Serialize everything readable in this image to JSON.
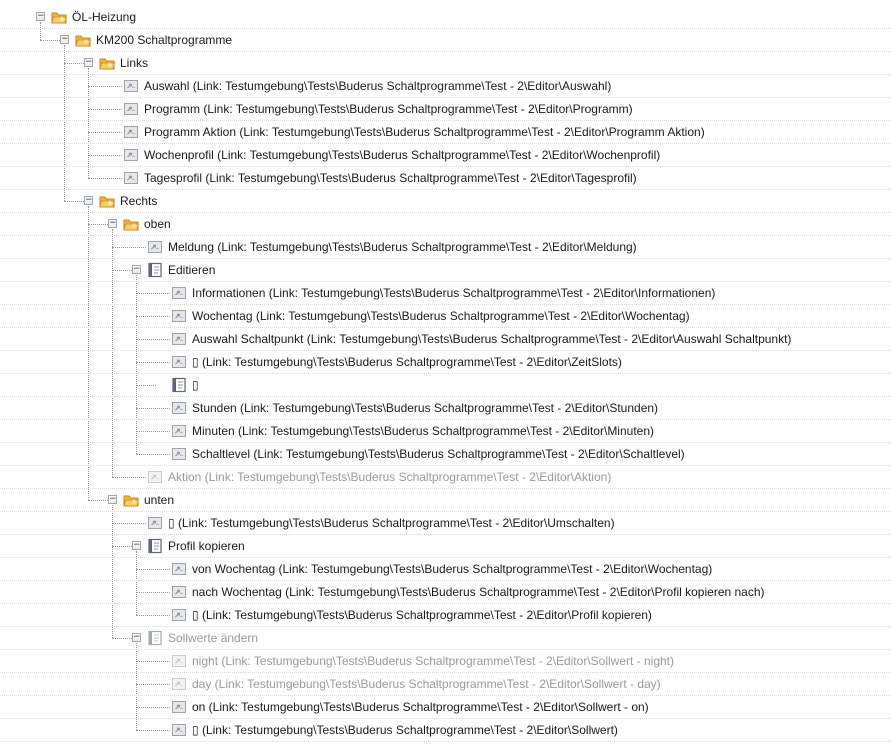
{
  "tree": [
    {
      "depth": 0,
      "type": "folder",
      "label": "ÖL-Heizung",
      "expanded": true,
      "dim": false
    },
    {
      "depth": 1,
      "type": "folder",
      "label": "KM200 Schaltprogramme",
      "expanded": true,
      "dim": false
    },
    {
      "depth": 2,
      "type": "folder",
      "label": "Links",
      "expanded": true,
      "dim": false
    },
    {
      "depth": 3,
      "type": "link",
      "label": "Auswahl (Link: Testumgebung\\Tests\\Buderus Schaltprogramme\\Test - 2\\Editor\\Auswahl)",
      "dim": false
    },
    {
      "depth": 3,
      "type": "link",
      "label": "Programm (Link: Testumgebung\\Tests\\Buderus Schaltprogramme\\Test - 2\\Editor\\Programm)",
      "dim": false
    },
    {
      "depth": 3,
      "type": "link",
      "label": "Programm Aktion (Link: Testumgebung\\Tests\\Buderus Schaltprogramme\\Test - 2\\Editor\\Programm Aktion)",
      "dim": false
    },
    {
      "depth": 3,
      "type": "link",
      "label": "Wochenprofil (Link: Testumgebung\\Tests\\Buderus Schaltprogramme\\Test - 2\\Editor\\Wochenprofil)",
      "dim": false
    },
    {
      "depth": 3,
      "type": "link",
      "label": "Tagesprofil (Link: Testumgebung\\Tests\\Buderus Schaltprogramme\\Test - 2\\Editor\\Tagesprofil)",
      "dim": false
    },
    {
      "depth": 2,
      "type": "folder",
      "label": "Rechts",
      "expanded": true,
      "dim": false
    },
    {
      "depth": 3,
      "type": "folder",
      "label": "oben",
      "expanded": true,
      "dim": false
    },
    {
      "depth": 4,
      "type": "link",
      "label": "Meldung (Link: Testumgebung\\Tests\\Buderus Schaltprogramme\\Test - 2\\Editor\\Meldung)",
      "dim": false
    },
    {
      "depth": 4,
      "type": "book",
      "label": "Editieren",
      "expanded": true,
      "dim": false
    },
    {
      "depth": 5,
      "type": "link",
      "label": "Informationen (Link: Testumgebung\\Tests\\Buderus Schaltprogramme\\Test - 2\\Editor\\Informationen)",
      "dim": false
    },
    {
      "depth": 5,
      "type": "link",
      "label": "Wochentag (Link: Testumgebung\\Tests\\Buderus Schaltprogramme\\Test - 2\\Editor\\Wochentag)",
      "dim": false
    },
    {
      "depth": 5,
      "type": "link",
      "label": "Auswahl Schaltpunkt (Link: Testumgebung\\Tests\\Buderus Schaltprogramme\\Test - 2\\Editor\\Auswahl Schaltpunkt)",
      "dim": false
    },
    {
      "depth": 5,
      "type": "link",
      "label": "▯ (Link: Testumgebung\\Tests\\Buderus Schaltprogramme\\Test - 2\\Editor\\ZeitSlots)",
      "dim": false
    },
    {
      "depth": 5,
      "type": "book",
      "label": "▯",
      "dim": false
    },
    {
      "depth": 5,
      "type": "link",
      "label": "Stunden (Link: Testumgebung\\Tests\\Buderus Schaltprogramme\\Test - 2\\Editor\\Stunden)",
      "dim": false
    },
    {
      "depth": 5,
      "type": "link",
      "label": "Minuten (Link: Testumgebung\\Tests\\Buderus Schaltprogramme\\Test - 2\\Editor\\Minuten)",
      "dim": false
    },
    {
      "depth": 5,
      "type": "link",
      "label": "Schaltlevel (Link: Testumgebung\\Tests\\Buderus Schaltprogramme\\Test - 2\\Editor\\Schaltlevel)",
      "dim": false
    },
    {
      "depth": 4,
      "type": "link",
      "label": "Aktion (Link: Testumgebung\\Tests\\Buderus Schaltprogramme\\Test - 2\\Editor\\Aktion)",
      "dim": true
    },
    {
      "depth": 3,
      "type": "folder",
      "label": "unten",
      "expanded": true,
      "dim": false
    },
    {
      "depth": 4,
      "type": "link",
      "label": "▯ (Link: Testumgebung\\Tests\\Buderus Schaltprogramme\\Test - 2\\Editor\\Umschalten)",
      "dim": false
    },
    {
      "depth": 4,
      "type": "book",
      "label": "Profil kopieren",
      "expanded": true,
      "dim": false
    },
    {
      "depth": 5,
      "type": "link",
      "label": "von Wochentag (Link: Testumgebung\\Tests\\Buderus Schaltprogramme\\Test - 2\\Editor\\Wochentag)",
      "dim": false
    },
    {
      "depth": 5,
      "type": "link",
      "label": "nach Wochentag (Link: Testumgebung\\Tests\\Buderus Schaltprogramme\\Test - 2\\Editor\\Profil kopieren nach)",
      "dim": false
    },
    {
      "depth": 5,
      "type": "link",
      "label": "▯ (Link: Testumgebung\\Tests\\Buderus Schaltprogramme\\Test - 2\\Editor\\Profil kopieren)",
      "dim": false
    },
    {
      "depth": 4,
      "type": "book",
      "label": "Sollwerte ändern",
      "expanded": true,
      "dim": true
    },
    {
      "depth": 5,
      "type": "link",
      "label": "night (Link: Testumgebung\\Tests\\Buderus Schaltprogramme\\Test - 2\\Editor\\Sollwert - night)",
      "dim": true
    },
    {
      "depth": 5,
      "type": "link",
      "label": "day (Link: Testumgebung\\Tests\\Buderus Schaltprogramme\\Test - 2\\Editor\\Sollwert - day)",
      "dim": true
    },
    {
      "depth": 5,
      "type": "link",
      "label": "on (Link: Testumgebung\\Tests\\Buderus Schaltprogramme\\Test - 2\\Editor\\Sollwert - on)",
      "dim": false
    },
    {
      "depth": 5,
      "type": "link",
      "label": "▯ (Link: Testumgebung\\Tests\\Buderus Schaltprogramme\\Test - 2\\Editor\\Sollwert)",
      "dim": false
    }
  ],
  "icons": {
    "folder": "folder-icon",
    "link": "link-icon",
    "book": "book-icon"
  },
  "colors": {
    "folder": "#f0b43a",
    "link_bg": "#e6e8ec",
    "book": "#5b6678",
    "grid": "#d9d9d9",
    "tree_line": "#9a9a9a",
    "dim_text": "#9a9a9a"
  }
}
